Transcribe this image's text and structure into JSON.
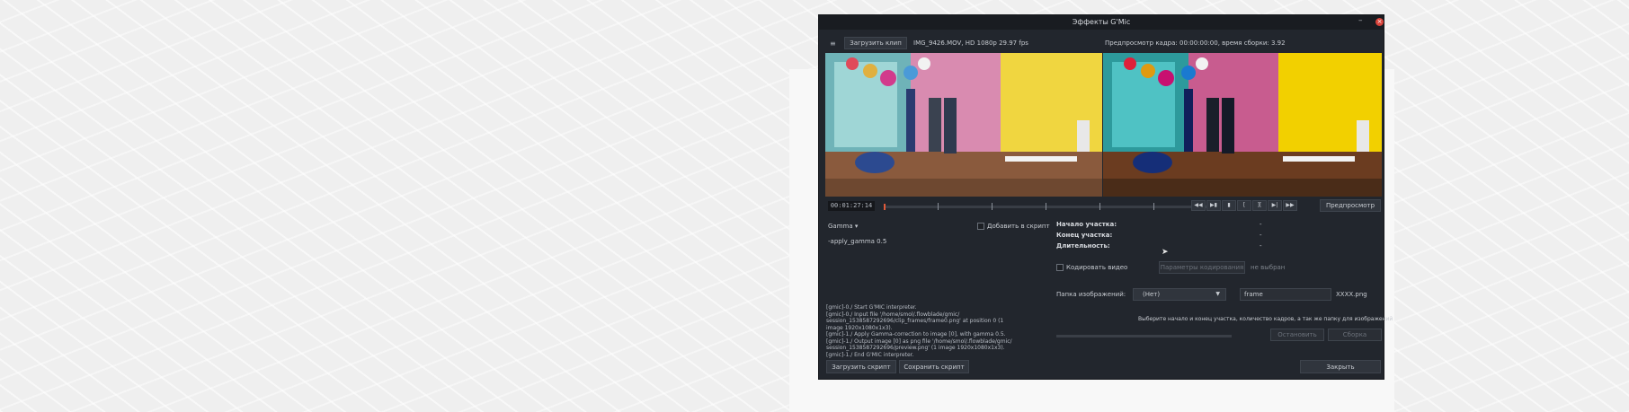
{
  "window": {
    "title": "Эффекты G'Mic",
    "min_glyph": "–",
    "close_glyph": "×"
  },
  "toolbar": {
    "menu_icon": "≡",
    "load_clip": "Загрузить клип",
    "clip_info": "IMG_9426.MOV, HD 1080p 29.97 fps",
    "preview_info": "Предпросмотр кадра: 00:00:00:00, время сборки: 3.92"
  },
  "transport": {
    "timecode": "00:01:27:14",
    "buttons": [
      "◀◀",
      "▶▮",
      "▮",
      "[",
      "][",
      "▶|",
      "▶▶"
    ],
    "preview_button": "Предпросмотр"
  },
  "filter": {
    "name": "Gamma",
    "add_to_script": "Добавить в скрипт",
    "command": "-apply_gamma 0.5"
  },
  "segment": {
    "start_label": "Начало участка:",
    "start_value": "-",
    "end_label": "Конец участка:",
    "end_value": "-",
    "duration_label": "Длительность:",
    "duration_value": "-"
  },
  "encode": {
    "checkbox_label": "Кодировать видео",
    "params_button": "Параметры кодирования",
    "status": "не выбран"
  },
  "images": {
    "folder_label": "Папка изображений:",
    "folder_value": "(Нет)",
    "prefix_value": "frame",
    "suffix": "XXXX.png",
    "hint": "Выберите начало и конец участка, количество кадров, а так же папку для изображений"
  },
  "actions": {
    "stop": "Остановить",
    "build": "Сборка",
    "close": "Закрыть"
  },
  "log_lines": [
    "[gmic]-0./ Start G'MIC interpreter.",
    "[gmic]-0./ Input file '/home/smol/.flowblade/gmic/",
    "session_1538587292696/clip_frames/frame0.png' at position 0 (1",
    "image 1920x1080x1x3).",
    "[gmic]-1./ Apply Gamma-correction to image [0], with gamma 0.5.",
    "[gmic]-1./ Output image [0] as png file '/home/smol/.flowblade/gmic/",
    "session_1538587292696/preview.png' (1 image 1920x1080x1x3).",
    "[gmic]-1./ End G'MIC interpreter."
  ],
  "script": {
    "load": "Загрузить скрипт",
    "save": "Сохранить скрипт"
  },
  "colors": {
    "window_bg": "#22262d",
    "accent_red": "#d9433a"
  },
  "icons": {
    "menu": "menu-icon",
    "close": "close-icon",
    "minimize": "minimize-icon",
    "dropdown": "chevron-down-icon"
  }
}
